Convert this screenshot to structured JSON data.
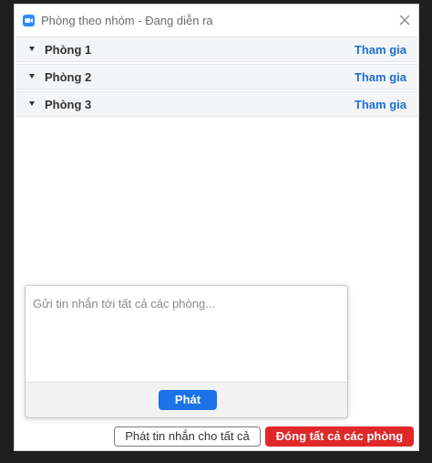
{
  "window": {
    "title": "Phòng theo nhóm - Đang diễn ra"
  },
  "rooms": [
    {
      "name": "Phòng 1",
      "join_label": "Tham gia"
    },
    {
      "name": "Phòng 2",
      "join_label": "Tham gia"
    },
    {
      "name": "Phòng 3",
      "join_label": "Tham gia"
    }
  ],
  "broadcast_popup": {
    "placeholder": "Gửi tin nhắn tới tất cả các phòng...",
    "value": "",
    "send_label": "Phát"
  },
  "footer": {
    "broadcast_label": "Phát tin nhắn cho tất cả",
    "close_all_label": "Đóng tất cả các phòng"
  },
  "colors": {
    "accent": "#1a73e8",
    "link": "#1a6fd6",
    "danger": "#e02828",
    "app_icon": "#2d8cff"
  }
}
